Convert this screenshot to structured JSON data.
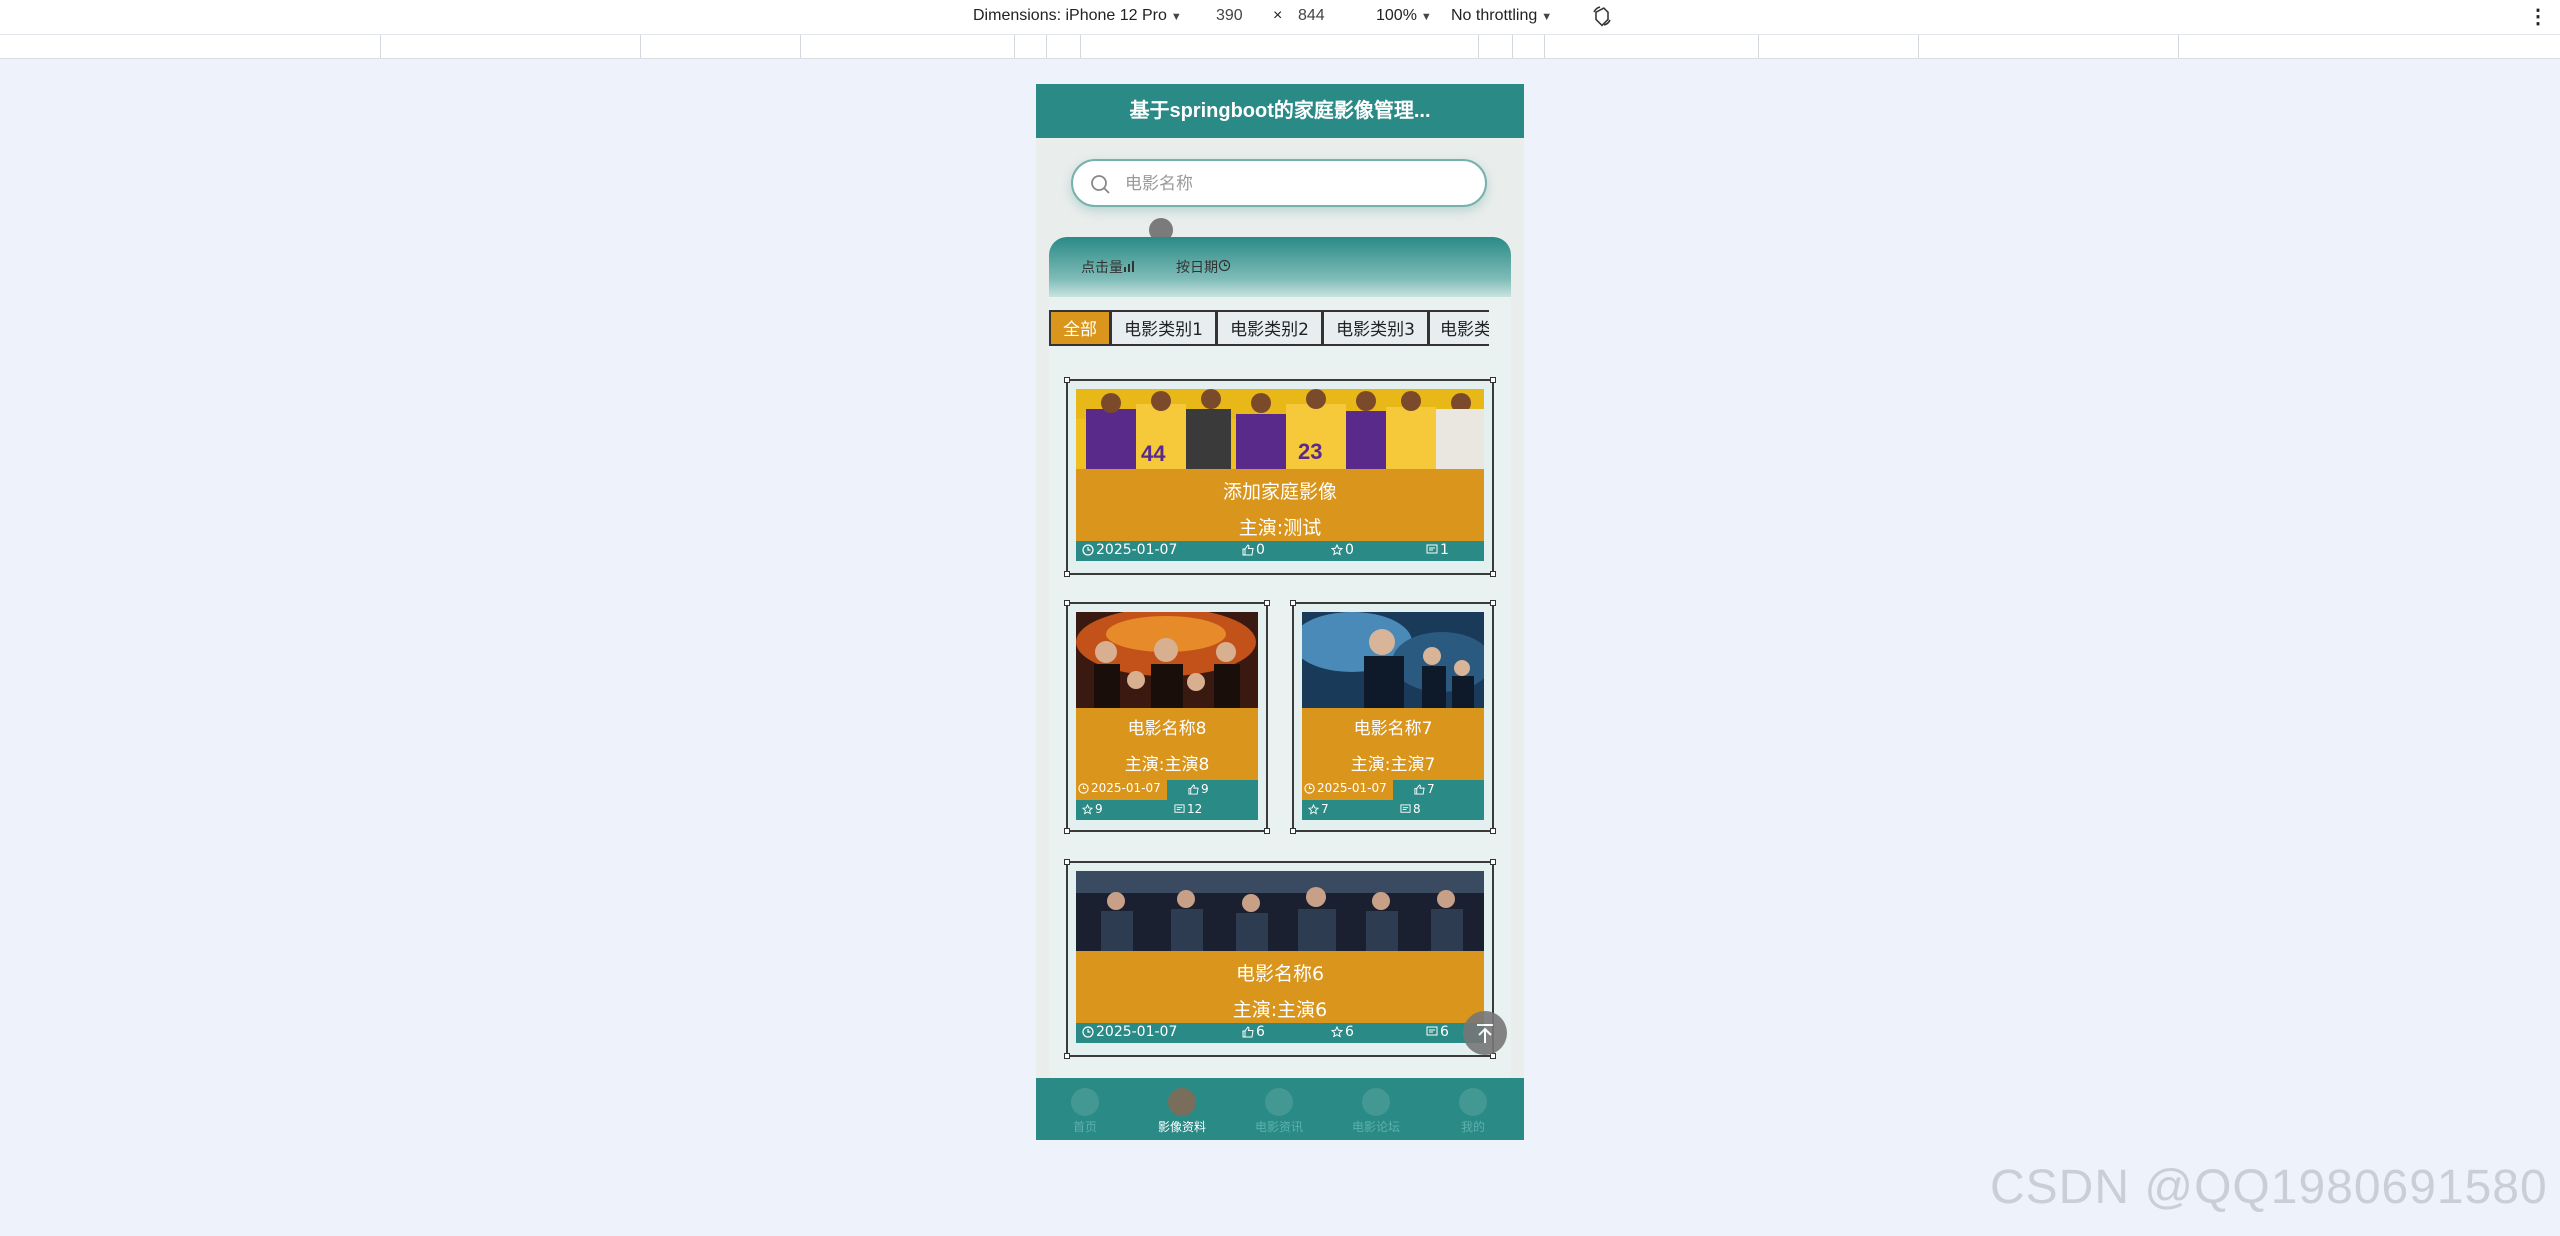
{
  "devtools": {
    "dimensions_label": "Dimensions: iPhone 12 Pro",
    "width_value": "390",
    "times": "×",
    "height_value": "844",
    "zoom": "100%",
    "throttling": "No throttling",
    "more_icon": "kebab-menu-icon",
    "rotate_icon": "rotate-device-icon"
  },
  "app": {
    "title": "基于springboot的家庭影像管理...",
    "search": {
      "placeholder": "电影名称",
      "value": ""
    },
    "sort": [
      {
        "label": "点击量",
        "icon": "bar-chart-icon"
      },
      {
        "label": "按日期",
        "icon": "clock-icon"
      }
    ],
    "categories": [
      "全部",
      "电影类别1",
      "电影类别2",
      "电影类别3",
      "电影类"
    ],
    "active_category": "全部",
    "cards": [
      {
        "name": "添加家庭影像",
        "cast": "主演:测试",
        "date": "2025-01-07",
        "likes": "0",
        "favorites": "0",
        "comments": "1",
        "image": "basketball-team-photo"
      },
      {
        "name": "电影名称8",
        "cast": "主演:主演8",
        "date": "2025-01-07",
        "likes": "9",
        "favorites": "9",
        "comments": "12",
        "image": "movie-poster-fire"
      },
      {
        "name": "电影名称7",
        "cast": "主演:主演7",
        "date": "2025-01-07",
        "likes": "7",
        "favorites": "7",
        "comments": "8",
        "image": "movie-poster-blue"
      },
      {
        "name": "电影名称6",
        "cast": "主演:主演6",
        "date": "2025-01-07",
        "likes": "6",
        "favorites": "6",
        "comments": "6",
        "image": "movie-poster-dark"
      }
    ],
    "tabbar": [
      {
        "label": "首页",
        "active": false
      },
      {
        "label": "影像资料",
        "active": true
      },
      {
        "label": "电影资讯",
        "active": false
      },
      {
        "label": "电影论坛",
        "active": false
      },
      {
        "label": "我的",
        "active": false
      }
    ]
  },
  "watermark": "CSDN @QQ1980691580",
  "colors": {
    "primary": "#2a8a86",
    "accent": "#d9951c",
    "background": "#eef2fa"
  }
}
